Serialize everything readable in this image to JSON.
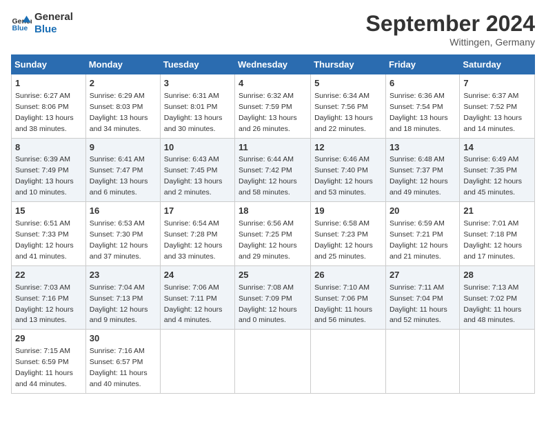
{
  "logo": {
    "line1": "General",
    "line2": "Blue"
  },
  "title": "September 2024",
  "location": "Wittingen, Germany",
  "days_of_week": [
    "Sunday",
    "Monday",
    "Tuesday",
    "Wednesday",
    "Thursday",
    "Friday",
    "Saturday"
  ],
  "weeks": [
    [
      {
        "day": "1",
        "sunrise": "6:27 AM",
        "sunset": "8:06 PM",
        "daylight": "13 hours and 38 minutes."
      },
      {
        "day": "2",
        "sunrise": "6:29 AM",
        "sunset": "8:03 PM",
        "daylight": "13 hours and 34 minutes."
      },
      {
        "day": "3",
        "sunrise": "6:31 AM",
        "sunset": "8:01 PM",
        "daylight": "13 hours and 30 minutes."
      },
      {
        "day": "4",
        "sunrise": "6:32 AM",
        "sunset": "7:59 PM",
        "daylight": "13 hours and 26 minutes."
      },
      {
        "day": "5",
        "sunrise": "6:34 AM",
        "sunset": "7:56 PM",
        "daylight": "13 hours and 22 minutes."
      },
      {
        "day": "6",
        "sunrise": "6:36 AM",
        "sunset": "7:54 PM",
        "daylight": "13 hours and 18 minutes."
      },
      {
        "day": "7",
        "sunrise": "6:37 AM",
        "sunset": "7:52 PM",
        "daylight": "13 hours and 14 minutes."
      }
    ],
    [
      {
        "day": "8",
        "sunrise": "6:39 AM",
        "sunset": "7:49 PM",
        "daylight": "13 hours and 10 minutes."
      },
      {
        "day": "9",
        "sunrise": "6:41 AM",
        "sunset": "7:47 PM",
        "daylight": "13 hours and 6 minutes."
      },
      {
        "day": "10",
        "sunrise": "6:43 AM",
        "sunset": "7:45 PM",
        "daylight": "13 hours and 2 minutes."
      },
      {
        "day": "11",
        "sunrise": "6:44 AM",
        "sunset": "7:42 PM",
        "daylight": "12 hours and 58 minutes."
      },
      {
        "day": "12",
        "sunrise": "6:46 AM",
        "sunset": "7:40 PM",
        "daylight": "12 hours and 53 minutes."
      },
      {
        "day": "13",
        "sunrise": "6:48 AM",
        "sunset": "7:37 PM",
        "daylight": "12 hours and 49 minutes."
      },
      {
        "day": "14",
        "sunrise": "6:49 AM",
        "sunset": "7:35 PM",
        "daylight": "12 hours and 45 minutes."
      }
    ],
    [
      {
        "day": "15",
        "sunrise": "6:51 AM",
        "sunset": "7:33 PM",
        "daylight": "12 hours and 41 minutes."
      },
      {
        "day": "16",
        "sunrise": "6:53 AM",
        "sunset": "7:30 PM",
        "daylight": "12 hours and 37 minutes."
      },
      {
        "day": "17",
        "sunrise": "6:54 AM",
        "sunset": "7:28 PM",
        "daylight": "12 hours and 33 minutes."
      },
      {
        "day": "18",
        "sunrise": "6:56 AM",
        "sunset": "7:25 PM",
        "daylight": "12 hours and 29 minutes."
      },
      {
        "day": "19",
        "sunrise": "6:58 AM",
        "sunset": "7:23 PM",
        "daylight": "12 hours and 25 minutes."
      },
      {
        "day": "20",
        "sunrise": "6:59 AM",
        "sunset": "7:21 PM",
        "daylight": "12 hours and 21 minutes."
      },
      {
        "day": "21",
        "sunrise": "7:01 AM",
        "sunset": "7:18 PM",
        "daylight": "12 hours and 17 minutes."
      }
    ],
    [
      {
        "day": "22",
        "sunrise": "7:03 AM",
        "sunset": "7:16 PM",
        "daylight": "12 hours and 13 minutes."
      },
      {
        "day": "23",
        "sunrise": "7:04 AM",
        "sunset": "7:13 PM",
        "daylight": "12 hours and 9 minutes."
      },
      {
        "day": "24",
        "sunrise": "7:06 AM",
        "sunset": "7:11 PM",
        "daylight": "12 hours and 4 minutes."
      },
      {
        "day": "25",
        "sunrise": "7:08 AM",
        "sunset": "7:09 PM",
        "daylight": "12 hours and 0 minutes."
      },
      {
        "day": "26",
        "sunrise": "7:10 AM",
        "sunset": "7:06 PM",
        "daylight": "11 hours and 56 minutes."
      },
      {
        "day": "27",
        "sunrise": "7:11 AM",
        "sunset": "7:04 PM",
        "daylight": "11 hours and 52 minutes."
      },
      {
        "day": "28",
        "sunrise": "7:13 AM",
        "sunset": "7:02 PM",
        "daylight": "11 hours and 48 minutes."
      }
    ],
    [
      {
        "day": "29",
        "sunrise": "7:15 AM",
        "sunset": "6:59 PM",
        "daylight": "11 hours and 44 minutes."
      },
      {
        "day": "30",
        "sunrise": "7:16 AM",
        "sunset": "6:57 PM",
        "daylight": "11 hours and 40 minutes."
      },
      null,
      null,
      null,
      null,
      null
    ]
  ]
}
